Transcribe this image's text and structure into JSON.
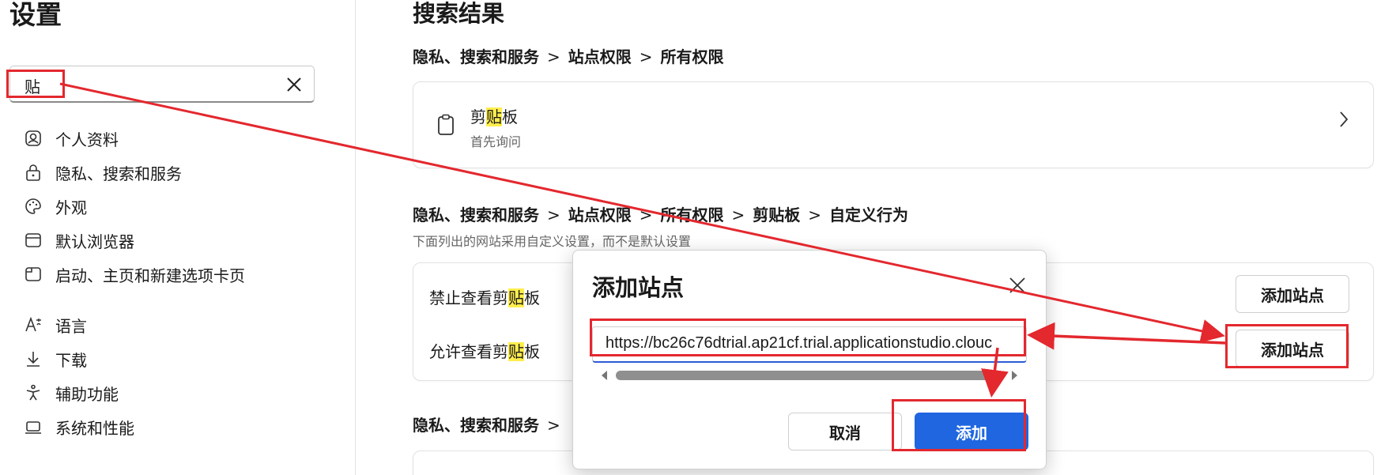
{
  "sidebar": {
    "title": "设置",
    "search": {
      "value": "贴"
    },
    "items": [
      {
        "label": "个人资料",
        "icon": "profile-icon"
      },
      {
        "label": "隐私、搜索和服务",
        "icon": "lock-icon"
      },
      {
        "label": "外观",
        "icon": "palette-icon"
      },
      {
        "label": "默认浏览器",
        "icon": "browser-icon"
      },
      {
        "label": "启动、主页和新建选项卡页",
        "icon": "home-icon"
      },
      {
        "label": "语言",
        "icon": "language-icon"
      },
      {
        "label": "下载",
        "icon": "download-icon"
      },
      {
        "label": "辅助功能",
        "icon": "accessibility-icon"
      },
      {
        "label": "系统和性能",
        "icon": "laptop-icon"
      }
    ]
  },
  "main": {
    "title": "搜索结果",
    "section1": {
      "crumbs": [
        "隐私、搜索和服务",
        "站点权限",
        "所有权限"
      ],
      "item": {
        "title_pre": "剪",
        "title_hl": "贴",
        "title_post": "板",
        "subtitle": "首先询问",
        "icon": "clipboard-icon"
      }
    },
    "section2": {
      "crumbs": [
        "隐私、搜索和服务",
        "站点权限",
        "所有权限",
        "剪贴板",
        "自定义行为"
      ],
      "description": "下面列出的网站采用自定义设置，而不是默认设置",
      "rows": [
        {
          "pre": "禁止查看剪",
          "hl": "贴",
          "post": "板",
          "button": "添加站点"
        },
        {
          "pre": "允许查看剪",
          "hl": "贴",
          "post": "板",
          "button": "添加站点"
        }
      ]
    },
    "section3": {
      "crumb_first": "隐私、搜索和服务"
    },
    "separator": ">"
  },
  "dialog": {
    "title": "添加站点",
    "url_value": "https://bc26c76dtrial.ap21cf.trial.applicationstudio.clouc",
    "cancel": "取消",
    "add": "添加"
  },
  "colors": {
    "accent": "#1f66e0",
    "highlight": "#ffee4d",
    "annotation": "#e3282e"
  }
}
